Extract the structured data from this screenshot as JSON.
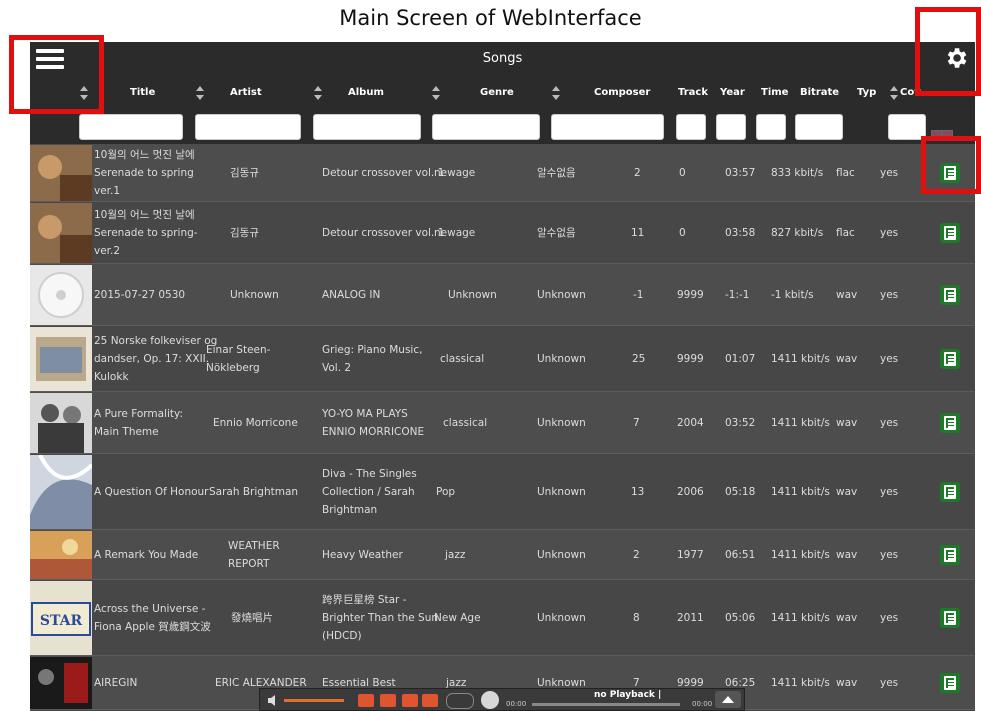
{
  "caption": "Main Screen of WebInterface",
  "header": {
    "title": "Songs"
  },
  "columns": [
    {
      "key": "title",
      "label": "Title"
    },
    {
      "key": "artist",
      "label": "Artist"
    },
    {
      "key": "album",
      "label": "Album"
    },
    {
      "key": "genre",
      "label": "Genre"
    },
    {
      "key": "composer",
      "label": "Composer"
    },
    {
      "key": "track",
      "label": "Track"
    },
    {
      "key": "year",
      "label": "Year"
    },
    {
      "key": "time",
      "label": "Time"
    },
    {
      "key": "bitrate",
      "label": "Bitrate"
    },
    {
      "key": "typ",
      "label": "Typ"
    },
    {
      "key": "cov",
      "label": "Cov"
    }
  ],
  "rows": [
    {
      "title": "10월의 어느 멋진 날에 Serenade to spring ver.1",
      "artist": "김동규",
      "album": "Detour crossover vol. 1",
      "genre": "newage",
      "composer": "알수없음",
      "track": "2",
      "year": "0",
      "time": "03:57",
      "bitrate": "833 kbit/s",
      "typ": "flac",
      "cov": "yes"
    },
    {
      "title": "10월의 어느 멋진 날에 Serenade to spring-ver.2",
      "artist": "김동규",
      "album": "Detour crossover vol. 1",
      "genre": "newage",
      "composer": "알수없음",
      "track": "11",
      "year": "0",
      "time": "03:58",
      "bitrate": "827 kbit/s",
      "typ": "flac",
      "cov": "yes"
    },
    {
      "title": "2015-07-27 0530",
      "artist": "Unknown",
      "album": "ANALOG IN",
      "genre": "Unknown",
      "composer": "Unknown",
      "track": "-1",
      "year": "9999",
      "time": "-1:-1",
      "bitrate": "-1 kbit/s",
      "typ": "wav",
      "cov": "yes"
    },
    {
      "title": "25 Norske folkeviser og dandser, Op. 17: XXII. Kulokk",
      "artist": "Einar Steen-Nökleberg",
      "album": "Grieg: Piano Music, Vol. 2",
      "genre": "classical",
      "composer": "Unknown",
      "track": "25",
      "year": "9999",
      "time": "01:07",
      "bitrate": "1411 kbit/s",
      "typ": "wav",
      "cov": "yes"
    },
    {
      "title": "A Pure Formality: Main Theme",
      "artist": "Ennio Morricone",
      "album": "YO-YO MA PLAYS ENNIO MORRICONE",
      "genre": "classical",
      "composer": "Unknown",
      "track": "7",
      "year": "2004",
      "time": "03:52",
      "bitrate": "1411 kbit/s",
      "typ": "wav",
      "cov": "yes"
    },
    {
      "title": "A Question Of Honour",
      "artist": "Sarah Brightman",
      "album": "Diva - The Singles Collection / Sarah Brightman",
      "genre": "Pop",
      "composer": "Unknown",
      "track": "13",
      "year": "2006",
      "time": "05:18",
      "bitrate": "1411 kbit/s",
      "typ": "wav",
      "cov": "yes"
    },
    {
      "title": "A Remark You Made",
      "artist": "WEATHER REPORT",
      "album": "Heavy Weather",
      "genre": "jazz",
      "composer": "Unknown",
      "track": "2",
      "year": "1977",
      "time": "06:51",
      "bitrate": "1411 kbit/s",
      "typ": "wav",
      "cov": "yes"
    },
    {
      "title": "Across the Universe -Fiona Apple 賀歲鋼文波",
      "artist": "發燒唱片",
      "album": "跨界巨星榜 Star - Brighter Than the Sun (HDCD)",
      "genre": "New Age",
      "composer": "Unknown",
      "track": "8",
      "year": "2011",
      "time": "05:06",
      "bitrate": "1411 kbit/s",
      "typ": "wav",
      "cov": "yes"
    },
    {
      "title": "AIREGIN",
      "artist": "ERIC ALEXANDER",
      "album": "Essential Best",
      "genre": "jazz",
      "composer": "Unknown",
      "track": "7",
      "year": "9999",
      "time": "06:25",
      "bitrate": "1411 kbit/s",
      "typ": "wav",
      "cov": "yes"
    }
  ],
  "player": {
    "status": "no Playback |",
    "elapsed": "00:00",
    "total": "00:00"
  },
  "colors": {
    "highlight": "#e01010",
    "copy_button": "#1d7a2a",
    "player_buttons": "#e05530"
  }
}
